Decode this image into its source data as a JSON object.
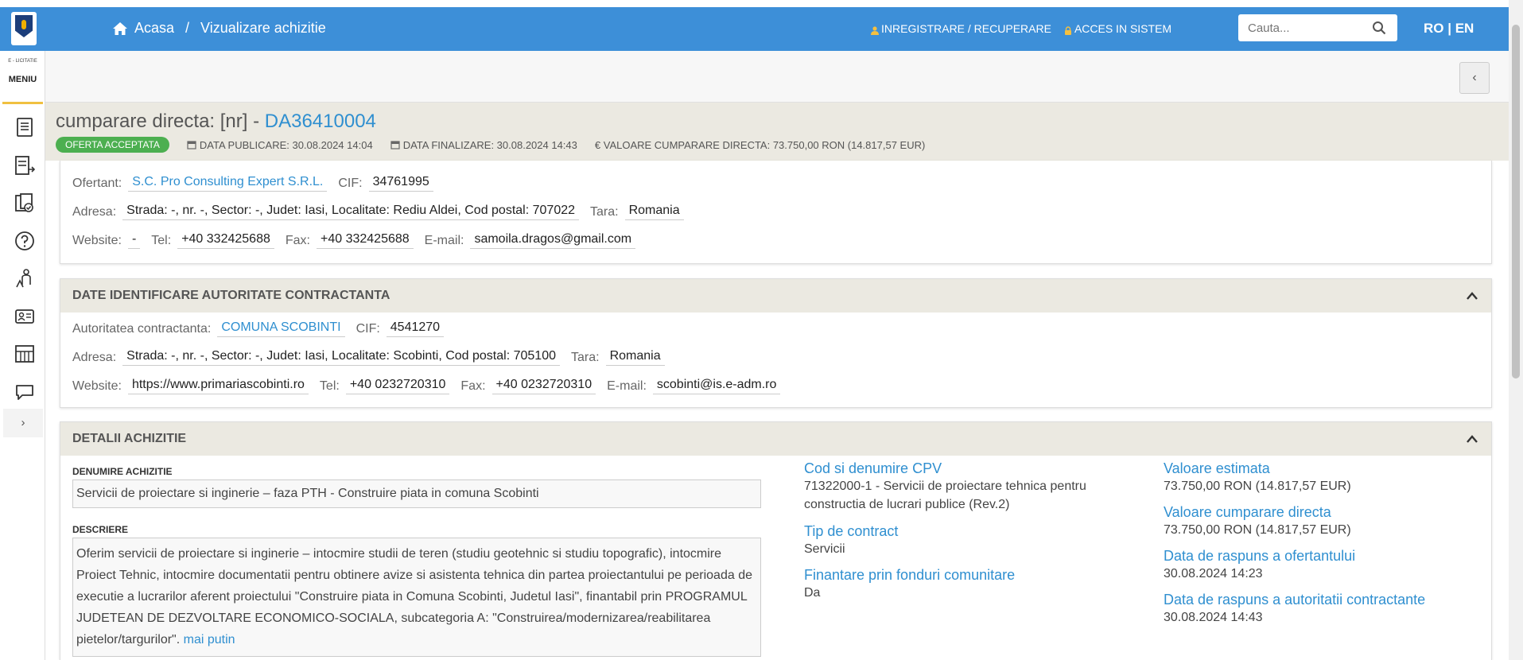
{
  "breadcrumb": {
    "home": "Acasa",
    "separator": "/",
    "current": "Vizualizare achizitie"
  },
  "top_links": {
    "register": "INREGISTRARE / RECUPERARE",
    "login": "ACCES IN SISTEM"
  },
  "search": {
    "placeholder": "Cauta..."
  },
  "lang": {
    "label": "RO | EN"
  },
  "sidebar": {
    "brand": "E - LICITATIE",
    "menu_label": "MENIU",
    "icons": [
      "document-list-icon",
      "export-list-icon",
      "checklist-icon",
      "help-icon",
      "user-tree-icon",
      "id-card-icon",
      "catalog-icon",
      "chat-icon"
    ],
    "expand": "›"
  },
  "subbar": {
    "collapse": "‹"
  },
  "header": {
    "title_prefix": "cumparare directa: [nr] - ",
    "code": "DA36410004",
    "status": "OFERTA ACCEPTATA",
    "publish": "DATA PUBLICARE: 30.08.2024 14:04",
    "finish": "DATA FINALIZARE: 30.08.2024 14:43",
    "value": "€ VALOARE CUMPARARE DIRECTA: 73.750,00  RON (14.817,57  EUR)"
  },
  "ofertant": {
    "ofertant_label": "Ofertant:",
    "ofertant_name": "S.C. Pro Consulting Expert S.R.L.",
    "cif_label": "CIF:",
    "cif": "34761995",
    "address_label": "Adresa:",
    "address": "Strada: -, nr. -, Sector: -, Judet: Iasi, Localitate: Rediu Aldei, Cod postal: 707022",
    "country_label": "Tara:",
    "country": "Romania",
    "website_label": "Website:",
    "website": "-",
    "tel_label": "Tel:",
    "tel": "+40 332425688",
    "fax_label": "Fax:",
    "fax": "+40 332425688",
    "email_label": "E-mail:",
    "email": "samoila.dragos@gmail.com"
  },
  "authority": {
    "section_title": "DATE IDENTIFICARE AUTORITATE CONTRACTANTA",
    "name_label": "Autoritatea contractanta:",
    "name": "COMUNA SCOBINTI",
    "cif_label": "CIF:",
    "cif": "4541270",
    "address_label": "Adresa:",
    "address": "Strada: -, nr. -, Sector: -, Judet: Iasi, Localitate: Scobinti, Cod postal: 705100",
    "country_label": "Tara:",
    "country": "Romania",
    "website_label": "Website:",
    "website": "https://www.primariascobinti.ro",
    "tel_label": "Tel:",
    "tel": "+40 0232720310",
    "fax_label": "Fax:",
    "fax": "+40 0232720310",
    "email_label": "E-mail:",
    "email": "scobinti@is.e-adm.ro"
  },
  "details": {
    "section_title": "DETALII ACHIZITIE",
    "name_label": "DENUMIRE ACHIZITIE",
    "name": "Servicii de proiectare si inginerie – faza PTH - Construire piata in comuna Scobinti",
    "desc_label": "DESCRIERE",
    "description": "Oferim servicii de proiectare si inginerie – intocmire studii de teren (studiu geotehnic si studiu topografic), intocmire Proiect Tehnic, intocmire documentatii pentru obtinere avize si asistenta tehnica din partea proiectantului pe perioada de executie a lucrarilor aferent proiectului \"Construire piata in Comuna Scobinti, Judetul Iasi\", finantabil prin PROGRAMUL JUDETEAN DE DEZVOLTARE ECONOMICO-SOCIALA, subcategoria A: \"Construirea/modernizarea/reabilitarea pietelor/targurilor\".",
    "less_link": "mai putin",
    "cpv_label": "Cod si denumire CPV",
    "cpv": "71322000-1 - Servicii de proiectare tehnica pentru constructia de lucrari publice (Rev.2)",
    "contract_type_label": "Tip de contract",
    "contract_type": "Servicii",
    "eu_funds_label": "Finantare prin fonduri comunitare",
    "eu_funds": "Da",
    "estimated_label": "Valoare estimata",
    "estimated": "73.750,00  RON (14.817,57  EUR)",
    "direct_value_label": "Valoare cumparare directa",
    "direct_value": "73.750,00  RON (14.817,57  EUR)",
    "bidder_date_label": "Data de raspuns a ofertantului",
    "bidder_date": "30.08.2024 14:23",
    "authority_date_label": "Data de raspuns a autoritatii contractante",
    "authority_date": "30.08.2024 14:43"
  }
}
